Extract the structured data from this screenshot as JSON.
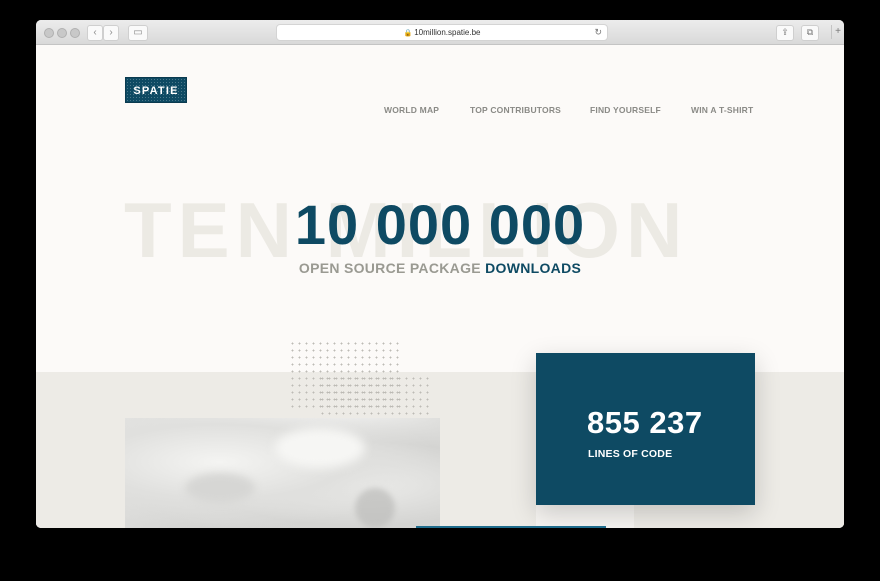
{
  "browser": {
    "url": "10million.spatie.be",
    "back_glyph": "‹",
    "forward_glyph": "›",
    "sidebar_glyph": "▭",
    "reload_glyph": "↻",
    "share_glyph": "⇪",
    "tabs_glyph": "⧉",
    "newtab_glyph": "+"
  },
  "header": {
    "logo": "SPATIE",
    "nav": [
      "WORLD MAP",
      "TOP CONTRIBUTORS",
      "FIND YOURSELF",
      "WIN A T-SHIRT"
    ]
  },
  "hero": {
    "background_word": "TEN MILLION",
    "number": "10 000 000",
    "subtitle_part1": "OPEN SOURCE PACKAGE ",
    "subtitle_part2": "DOWNLOADS"
  },
  "stat": {
    "value": "855 237",
    "label": "LINES OF CODE"
  },
  "colors": {
    "brand": "#0e4a63",
    "muted_text": "#9a9a92",
    "page_bg": "#fcfaf8",
    "band_bg": "#edebe6"
  }
}
